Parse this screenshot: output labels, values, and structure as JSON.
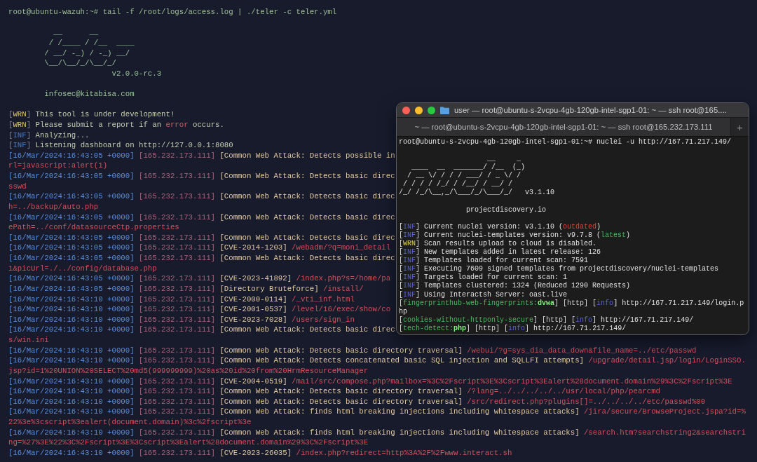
{
  "main_terminal": {
    "lines": [
      {
        "kind": "command",
        "segments": [
          {
            "text": "root@ubuntu-wazuh:~# tail -f /root/logs/access.log | ./teler -c teler.yml",
            "kind": "prompt"
          }
        ]
      },
      {
        "kind": "blank"
      },
      {
        "kind": "logo",
        "segments": [
          {
            "text": "          __      __",
            "kind": "logo"
          }
        ]
      },
      {
        "kind": "logo",
        "segments": [
          {
            "text": "         / /____ / /__  ____",
            "kind": "logo"
          }
        ]
      },
      {
        "kind": "logo",
        "segments": [
          {
            "text": "        / __/ -_) / -_) __/",
            "kind": "logo"
          }
        ]
      },
      {
        "kind": "logo",
        "segments": [
          {
            "text": "        \\__/\\__/_/\\__/_/",
            "kind": "logo"
          }
        ]
      },
      {
        "kind": "version",
        "segments": [
          {
            "text": "                       v2.0.0-rc.3",
            "kind": "logo"
          }
        ]
      },
      {
        "kind": "blank"
      },
      {
        "kind": "text",
        "segments": [
          {
            "text": "        infosec@kitabisa.com",
            "kind": "logo"
          }
        ]
      },
      {
        "kind": "blank"
      },
      {
        "kind": "text",
        "segments": [
          {
            "text": "[",
            "kind": "dim"
          },
          {
            "text": "WRN",
            "kind": "warn"
          },
          {
            "text": "] ",
            "kind": "dim"
          },
          {
            "text": "This tool is under development!",
            "kind": "plain"
          }
        ]
      },
      {
        "kind": "text",
        "segments": [
          {
            "text": "[",
            "kind": "dim"
          },
          {
            "text": "WRN",
            "kind": "warn"
          },
          {
            "text": "] ",
            "kind": "dim"
          },
          {
            "text": "Please submit a report if an ",
            "kind": "plain"
          },
          {
            "text": "error",
            "kind": "error"
          },
          {
            "text": " occurs.",
            "kind": "plain"
          }
        ]
      },
      {
        "kind": "text",
        "segments": [
          {
            "text": "[",
            "kind": "dim"
          },
          {
            "text": "INF",
            "kind": "info"
          },
          {
            "text": "] ",
            "kind": "dim"
          },
          {
            "text": "Analyzing...",
            "kind": "plain"
          }
        ]
      },
      {
        "kind": "text",
        "segments": [
          {
            "text": "[",
            "kind": "dim"
          },
          {
            "text": "INF",
            "kind": "info"
          },
          {
            "text": "] ",
            "kind": "dim"
          },
          {
            "text": "Listening dashboard on http://127.0.0.1:8080",
            "kind": "plain"
          }
        ]
      },
      {
        "kind": "log",
        "segments": [
          {
            "text": "[16/Mar/2024:16:43:05 +0000]",
            "kind": "time"
          },
          {
            "text": " [165.232.173.111]",
            "kind": "ip"
          },
          {
            "text": " [Common Web Attack: Detects possible in",
            "kind": "tag"
          }
        ]
      },
      {
        "kind": "wrap",
        "segments": [
          {
            "text": "rl=javascript:alert(1)",
            "kind": "path"
          }
        ]
      },
      {
        "kind": "log",
        "segments": [
          {
            "text": "[16/Mar/2024:16:43:05 +0000]",
            "kind": "time"
          },
          {
            "text": " [165.232.173.111]",
            "kind": "ip"
          },
          {
            "text": " [Common Web Attack: Detects basic direc",
            "kind": "tag"
          }
        ]
      },
      {
        "kind": "wrap",
        "segments": [
          {
            "text": "sswd",
            "kind": "path"
          }
        ]
      },
      {
        "kind": "log",
        "segments": [
          {
            "text": "[16/Mar/2024:16:43:05 +0000]",
            "kind": "time"
          },
          {
            "text": " [165.232.173.111]",
            "kind": "ip"
          },
          {
            "text": " [Common Web Attack: Detects basic direc",
            "kind": "tag"
          }
        ]
      },
      {
        "kind": "wrap",
        "segments": [
          {
            "text": "h=../backup/auto.php",
            "kind": "path"
          }
        ]
      },
      {
        "kind": "log",
        "segments": [
          {
            "text": "[16/Mar/2024:16:43:05 +0000]",
            "kind": "time"
          },
          {
            "text": " [165.232.173.111]",
            "kind": "ip"
          },
          {
            "text": " [Common Web Attack: Detects basic direc",
            "kind": "tag"
          }
        ]
      },
      {
        "kind": "wrap",
        "segments": [
          {
            "text": "ePath=../conf/datasourceCtp.properties",
            "kind": "path"
          }
        ]
      },
      {
        "kind": "log",
        "segments": [
          {
            "text": "[16/Mar/2024:16:43:05 +0000]",
            "kind": "time"
          },
          {
            "text": " [165.232.173.111]",
            "kind": "ip"
          },
          {
            "text": " [Common Web Attack: Detects basic direc",
            "kind": "tag"
          }
        ]
      },
      {
        "kind": "log",
        "segments": [
          {
            "text": "[16/Mar/2024:16:43:05 +0000]",
            "kind": "time"
          },
          {
            "text": " [165.232.173.111]",
            "kind": "ip"
          },
          {
            "text": " [CVE-2014-1203]",
            "kind": "tag"
          },
          {
            "text": " /webadm/?q=moni_detail",
            "kind": "path"
          }
        ]
      },
      {
        "kind": "log",
        "segments": [
          {
            "text": "[16/Mar/2024:16:43:05 +0000]",
            "kind": "time"
          },
          {
            "text": " [165.232.173.111]",
            "kind": "ip"
          },
          {
            "text": " [Common Web Attack: Detects basic direc",
            "kind": "tag"
          }
        ]
      },
      {
        "kind": "wrap",
        "segments": [
          {
            "text": "1&picUrl=./../config/database.php",
            "kind": "path"
          }
        ]
      },
      {
        "kind": "log",
        "segments": [
          {
            "text": "[16/Mar/2024:16:43:05 +0000]",
            "kind": "time"
          },
          {
            "text": " [165.232.173.111]",
            "kind": "ip"
          },
          {
            "text": " [CVE-2023-41892]",
            "kind": "tag"
          },
          {
            "text": " /index.php?s=/home/pa",
            "kind": "path"
          }
        ]
      },
      {
        "kind": "log",
        "segments": [
          {
            "text": "[16/Mar/2024:16:43:05 +0000]",
            "kind": "time"
          },
          {
            "text": " [165.232.173.111]",
            "kind": "ip"
          },
          {
            "text": " [Directory Bruteforce]",
            "kind": "tag"
          },
          {
            "text": " /install/",
            "kind": "path"
          }
        ]
      },
      {
        "kind": "log",
        "segments": [
          {
            "text": "[16/Mar/2024:16:43:10 +0000]",
            "kind": "time"
          },
          {
            "text": " [165.232.173.111]",
            "kind": "ip"
          },
          {
            "text": " [CVE-2000-0114]",
            "kind": "tag"
          },
          {
            "text": " /_vti_inf.html",
            "kind": "path"
          }
        ]
      },
      {
        "kind": "log",
        "segments": [
          {
            "text": "[16/Mar/2024:16:43:10 +0000]",
            "kind": "time"
          },
          {
            "text": " [165.232.173.111]",
            "kind": "ip"
          },
          {
            "text": " [CVE-2001-0537]",
            "kind": "tag"
          },
          {
            "text": " /level/16/exec/show/co",
            "kind": "path"
          }
        ]
      },
      {
        "kind": "log",
        "segments": [
          {
            "text": "[16/Mar/2024:16:43:10 +0000]",
            "kind": "time"
          },
          {
            "text": " [165.232.173.111]",
            "kind": "ip"
          },
          {
            "text": " [CVE-2023-7028]",
            "kind": "tag"
          },
          {
            "text": " /users/sign_in",
            "kind": "path"
          }
        ]
      },
      {
        "kind": "log",
        "segments": [
          {
            "text": "[16/Mar/2024:16:43:10 +0000]",
            "kind": "time"
          },
          {
            "text": " [165.232.173.111]",
            "kind": "ip"
          },
          {
            "text": " [Common Web Attack: Detects basic direc",
            "kind": "tag"
          }
        ]
      },
      {
        "kind": "wrap",
        "segments": [
          {
            "text": "s/win.ini",
            "kind": "path"
          }
        ]
      },
      {
        "kind": "log",
        "segments": [
          {
            "text": "[16/Mar/2024:16:43:10 +0000]",
            "kind": "time"
          },
          {
            "text": " [165.232.173.111]",
            "kind": "ip"
          },
          {
            "text": " [Common Web Attack: Detects basic directory traversal]",
            "kind": "tag"
          },
          {
            "text": " /webui/?g=sys_dia_data_down&file_name=../etc/passwd",
            "kind": "path"
          }
        ]
      },
      {
        "kind": "log",
        "segments": [
          {
            "text": "[16/Mar/2024:16:43:10 +0000]",
            "kind": "time"
          },
          {
            "text": " [165.232.173.111]",
            "kind": "ip"
          },
          {
            "text": " [Common Web Attack: Detects concatenated basic SQL injection and SQLLFI attempts]",
            "kind": "tag"
          },
          {
            "text": " /upgrade/detail.jsp/login/LoginSSO.",
            "kind": "path"
          }
        ]
      },
      {
        "kind": "wrap",
        "segments": [
          {
            "text": "jsp?id=1%20UNION%20SELECT%20md5(999999999)%20as%20id%20from%20HrmResourceManager",
            "kind": "path"
          }
        ]
      },
      {
        "kind": "log",
        "segments": [
          {
            "text": "[16/Mar/2024:16:43:10 +0000]",
            "kind": "time"
          },
          {
            "text": " [165.232.173.111]",
            "kind": "ip"
          },
          {
            "text": " [CVE-2004-0519]",
            "kind": "tag"
          },
          {
            "text": " /mail/src/compose.php?mailbox=%3C%2Fscript%3E%3Cscript%3Ealert%28document.domain%29%3C%2Fscript%3E",
            "kind": "path"
          }
        ]
      },
      {
        "kind": "log",
        "segments": [
          {
            "text": "[16/Mar/2024:16:43:10 +0000]",
            "kind": "time"
          },
          {
            "text": " [165.232.173.111]",
            "kind": "ip"
          },
          {
            "text": " [Common Web Attack: Detects basic directory traversal]",
            "kind": "tag"
          },
          {
            "text": " /?lang=../../../../../usr/local/php/pearcmd",
            "kind": "path"
          }
        ]
      },
      {
        "kind": "log",
        "segments": [
          {
            "text": "[16/Mar/2024:16:43:10 +0000]",
            "kind": "time"
          },
          {
            "text": " [165.232.173.111]",
            "kind": "ip"
          },
          {
            "text": " [Common Web Attack: Detects basic directory traversal]",
            "kind": "tag"
          },
          {
            "text": " /src/redirect.php?plugins[]=../../../../etc/passwd%00",
            "kind": "path"
          }
        ]
      },
      {
        "kind": "log",
        "segments": [
          {
            "text": "[16/Mar/2024:16:43:10 +0000]",
            "kind": "time"
          },
          {
            "text": " [165.232.173.111]",
            "kind": "ip"
          },
          {
            "text": " [Common Web Attack: finds html breaking injections including whitespace attacks]",
            "kind": "tag"
          },
          {
            "text": " /jira/secure/BrowseProject.jspa?id=%",
            "kind": "path"
          }
        ]
      },
      {
        "kind": "wrap",
        "segments": [
          {
            "text": "22%3e%3cscript%3ealert(document.domain)%3c%2fscript%3e",
            "kind": "path"
          }
        ]
      },
      {
        "kind": "log",
        "segments": [
          {
            "text": "[16/Mar/2024:16:43:10 +0000]",
            "kind": "time"
          },
          {
            "text": " [165.232.173.111]",
            "kind": "ip"
          },
          {
            "text": " [Common Web Attack: finds html breaking injections including whitespace attacks]",
            "kind": "tag"
          },
          {
            "text": " /search.htm?searchstring2&searchstri",
            "kind": "path"
          }
        ]
      },
      {
        "kind": "wrap",
        "segments": [
          {
            "text": "ng=%27%3E%22%3C%2Fscript%3E%3Cscript%3Ealert%28document.domain%29%3C%2Fscript%3E",
            "kind": "path"
          }
        ]
      },
      {
        "kind": "log",
        "segments": [
          {
            "text": "[16/Mar/2024:16:43:10 +0000]",
            "kind": "time"
          },
          {
            "text": " [165.232.173.111]",
            "kind": "ip"
          },
          {
            "text": " [CVE-2023-26035]",
            "kind": "tag"
          },
          {
            "text": " /index.php?redirect=http%3A%2F%2Fwww.interact.sh",
            "kind": "path"
          }
        ]
      }
    ]
  },
  "overlay_window": {
    "title": "user — root@ubuntu-s-2vcpu-4gb-120gb-intel-sgp1-01: ~ — ssh root@165....",
    "tab": "~ — root@ubuntu-s-2vcpu-4gb-120gb-intel-sgp1-01: ~ — ssh root@165.232.173.111",
    "new_tab": "+",
    "lines": [
      {
        "kind": "command",
        "segments": [
          {
            "text": "root@ubuntu-s-2vcpu-4gb-120gb-intel-sgp1-01:~# nuclei -u http://167.71.217.149/",
            "kind": "plain"
          }
        ]
      },
      {
        "kind": "blank"
      },
      {
        "kind": "logo",
        "segments": [
          {
            "text": "                     __     _",
            "kind": "plain"
          }
        ]
      },
      {
        "kind": "logo",
        "segments": [
          {
            "text": "   ____  __  _______/ /__  (_)",
            "kind": "plain"
          }
        ]
      },
      {
        "kind": "logo",
        "segments": [
          {
            "text": "  / __ \\/ / / / ___/ / _ \\/ /",
            "kind": "plain"
          }
        ]
      },
      {
        "kind": "logo",
        "segments": [
          {
            "text": " / / / / /_/ / /__/ / __/ /",
            "kind": "plain"
          }
        ]
      },
      {
        "kind": "logo",
        "segments": [
          {
            "text": "/_/ /_/\\__,_/\\___/_/\\___/_/   v3.1.10",
            "kind": "plain"
          }
        ]
      },
      {
        "kind": "blank"
      },
      {
        "kind": "text",
        "segments": [
          {
            "text": "                projectdiscovery.io",
            "kind": "plain"
          }
        ]
      },
      {
        "kind": "blank"
      },
      {
        "kind": "text",
        "segments": [
          {
            "text": "[",
            "kind": "plain"
          },
          {
            "text": "INF",
            "kind": "info"
          },
          {
            "text": "] Current nuclei version: v3.1.10 (",
            "kind": "plain"
          },
          {
            "text": "outdated",
            "kind": "error"
          },
          {
            "text": ")",
            "kind": "plain"
          }
        ]
      },
      {
        "kind": "text",
        "segments": [
          {
            "text": "[",
            "kind": "plain"
          },
          {
            "text": "INF",
            "kind": "info"
          },
          {
            "text": "] Current nuclei-templates version: v9.7.8 (",
            "kind": "plain"
          },
          {
            "text": "latest",
            "kind": "green"
          },
          {
            "text": ")",
            "kind": "plain"
          }
        ]
      },
      {
        "kind": "text",
        "segments": [
          {
            "text": "[",
            "kind": "plain"
          },
          {
            "text": "WRN",
            "kind": "warn"
          },
          {
            "text": "] Scan results upload to cloud is disabled.",
            "kind": "plain"
          }
        ]
      },
      {
        "kind": "text",
        "segments": [
          {
            "text": "[",
            "kind": "plain"
          },
          {
            "text": "INF",
            "kind": "info"
          },
          {
            "text": "] New templates added in latest release: 126",
            "kind": "plain"
          }
        ]
      },
      {
        "kind": "text",
        "segments": [
          {
            "text": "[",
            "kind": "plain"
          },
          {
            "text": "INF",
            "kind": "info"
          },
          {
            "text": "] Templates loaded for current scan: 7591",
            "kind": "plain"
          }
        ]
      },
      {
        "kind": "text",
        "segments": [
          {
            "text": "[",
            "kind": "plain"
          },
          {
            "text": "INF",
            "kind": "info"
          },
          {
            "text": "] Executing 7609 signed templates from projectdiscovery/nuclei-templates",
            "kind": "plain"
          }
        ]
      },
      {
        "kind": "text",
        "segments": [
          {
            "text": "[",
            "kind": "plain"
          },
          {
            "text": "INF",
            "kind": "info"
          },
          {
            "text": "] Targets loaded for current scan: 1",
            "kind": "plain"
          }
        ]
      },
      {
        "kind": "text",
        "segments": [
          {
            "text": "[",
            "kind": "plain"
          },
          {
            "text": "INF",
            "kind": "info"
          },
          {
            "text": "] Templates clustered: 1324 (Reduced 1290 Requests)",
            "kind": "plain"
          }
        ]
      },
      {
        "kind": "text",
        "segments": [
          {
            "text": "[",
            "kind": "plain"
          },
          {
            "text": "INF",
            "kind": "info"
          },
          {
            "text": "] Using Interactsh Server: oast.live",
            "kind": "plain"
          }
        ]
      },
      {
        "kind": "log",
        "segments": [
          {
            "text": "[",
            "kind": "plain"
          },
          {
            "text": "fingerprinthub-web-fingerprints:",
            "kind": "green"
          },
          {
            "text": "dvwa",
            "kind": "bright"
          },
          {
            "text": "] [",
            "kind": "plain"
          },
          {
            "text": "http",
            "kind": "http"
          },
          {
            "text": "] [",
            "kind": "plain"
          },
          {
            "text": "info",
            "kind": "info"
          },
          {
            "text": "] http://167.71.217.149/login.p",
            "kind": "plain"
          }
        ]
      },
      {
        "kind": "wrap",
        "segments": [
          {
            "text": "hp",
            "kind": "plain"
          }
        ]
      },
      {
        "kind": "log",
        "segments": [
          {
            "text": "[",
            "kind": "plain"
          },
          {
            "text": "cookies-without-httponly-secure",
            "kind": "green"
          },
          {
            "text": "] [",
            "kind": "plain"
          },
          {
            "text": "http",
            "kind": "http"
          },
          {
            "text": "] [",
            "kind": "plain"
          },
          {
            "text": "info",
            "kind": "info"
          },
          {
            "text": "] http://167.71.217.149/",
            "kind": "plain"
          }
        ]
      },
      {
        "kind": "log",
        "segments": [
          {
            "text": "[",
            "kind": "plain"
          },
          {
            "text": "tech-detect:",
            "kind": "green"
          },
          {
            "text": "php",
            "kind": "bright"
          },
          {
            "text": "] [",
            "kind": "plain"
          },
          {
            "text": "http",
            "kind": "http"
          },
          {
            "text": "] [",
            "kind": "plain"
          },
          {
            "text": "info",
            "kind": "info"
          },
          {
            "text": "] http://167.71.217.149/",
            "kind": "plain"
          }
        ]
      }
    ]
  }
}
